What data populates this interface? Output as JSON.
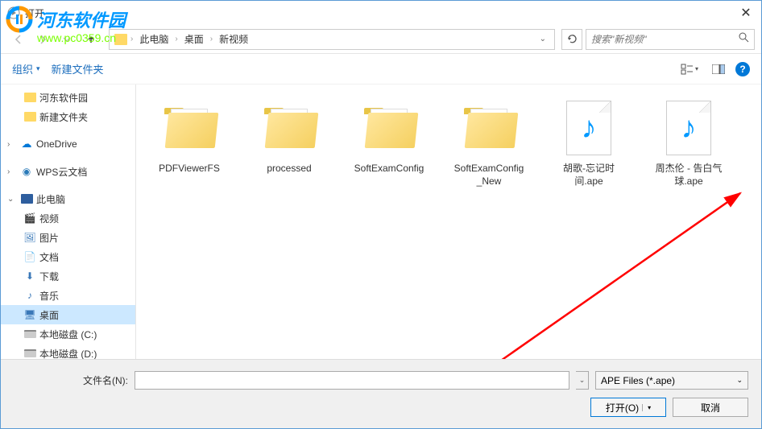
{
  "titlebar": {
    "title": "打开"
  },
  "watermark": {
    "text": "河东软件园",
    "url": "www.pc0359.cn"
  },
  "breadcrumb": {
    "items": [
      "此电脑",
      "桌面",
      "新视频"
    ]
  },
  "search": {
    "placeholder": "搜索\"新视频\""
  },
  "toolbar": {
    "organize": "组织",
    "newfolder": "新建文件夹"
  },
  "sidebar": {
    "items": [
      {
        "label": "河东软件园",
        "type": "folder",
        "indent": 1
      },
      {
        "label": "新建文件夹",
        "type": "folder",
        "indent": 1
      },
      {
        "label": "OneDrive",
        "type": "onedrive",
        "indent": 0,
        "arrow": "›"
      },
      {
        "label": "WPS云文档",
        "type": "wps",
        "indent": 0,
        "arrow": "›"
      },
      {
        "label": "此电脑",
        "type": "pc",
        "indent": 0,
        "arrow": "⌄"
      },
      {
        "label": "视频",
        "type": "video",
        "indent": 1
      },
      {
        "label": "图片",
        "type": "image",
        "indent": 1
      },
      {
        "label": "文档",
        "type": "doc",
        "indent": 1
      },
      {
        "label": "下载",
        "type": "download",
        "indent": 1
      },
      {
        "label": "音乐",
        "type": "music",
        "indent": 1
      },
      {
        "label": "桌面",
        "type": "desktop",
        "indent": 1,
        "selected": true
      },
      {
        "label": "本地磁盘 (C:)",
        "type": "disk",
        "indent": 1
      },
      {
        "label": "本地磁盘 (D:)",
        "type": "disk",
        "indent": 1
      }
    ]
  },
  "files": [
    {
      "name": "PDFViewerFS",
      "type": "folder"
    },
    {
      "name": "processed",
      "type": "folder"
    },
    {
      "name": "SoftExamConfig",
      "type": "folder"
    },
    {
      "name": "SoftExamConfig_New",
      "type": "folder"
    },
    {
      "name": "胡歌-忘记时间.ape",
      "type": "audio"
    },
    {
      "name": "周杰伦 - 告白气球.ape",
      "type": "audio"
    }
  ],
  "footer": {
    "filename_label": "文件名(N):",
    "filetype": "APE Files (*.ape)",
    "open_btn": "打开(O)",
    "cancel_btn": "取消"
  }
}
